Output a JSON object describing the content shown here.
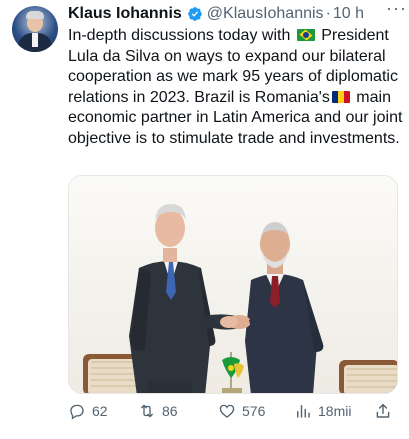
{
  "author": {
    "name": "Klaus Iohannis",
    "handle": "@KlausIohannis",
    "separator": "·",
    "time": "10 h"
  },
  "tweet": {
    "text_1": "In-depth discussions today with ",
    "text_2": " President Lula da Silva on ways to expand our bilateral cooperation as we mark 95 years of diplomatic relations in 2023. Brazil is Romania's",
    "text_3": " main economic partner in Latin America and our joint objective is to stimulate trade and investments."
  },
  "flags": {
    "brazil": "flag-brazil-icon",
    "romania": "flag-romania-icon",
    "romania_colors": [
      "#002b7f",
      "#fcd116",
      "#ce1126"
    ]
  },
  "actions": {
    "replies": "62",
    "reposts": "86",
    "likes": "576",
    "views": "18mii"
  },
  "colors": {
    "verified": "#1d9bf0",
    "secondary_text": "#536471",
    "primary_text": "#0f1419"
  }
}
